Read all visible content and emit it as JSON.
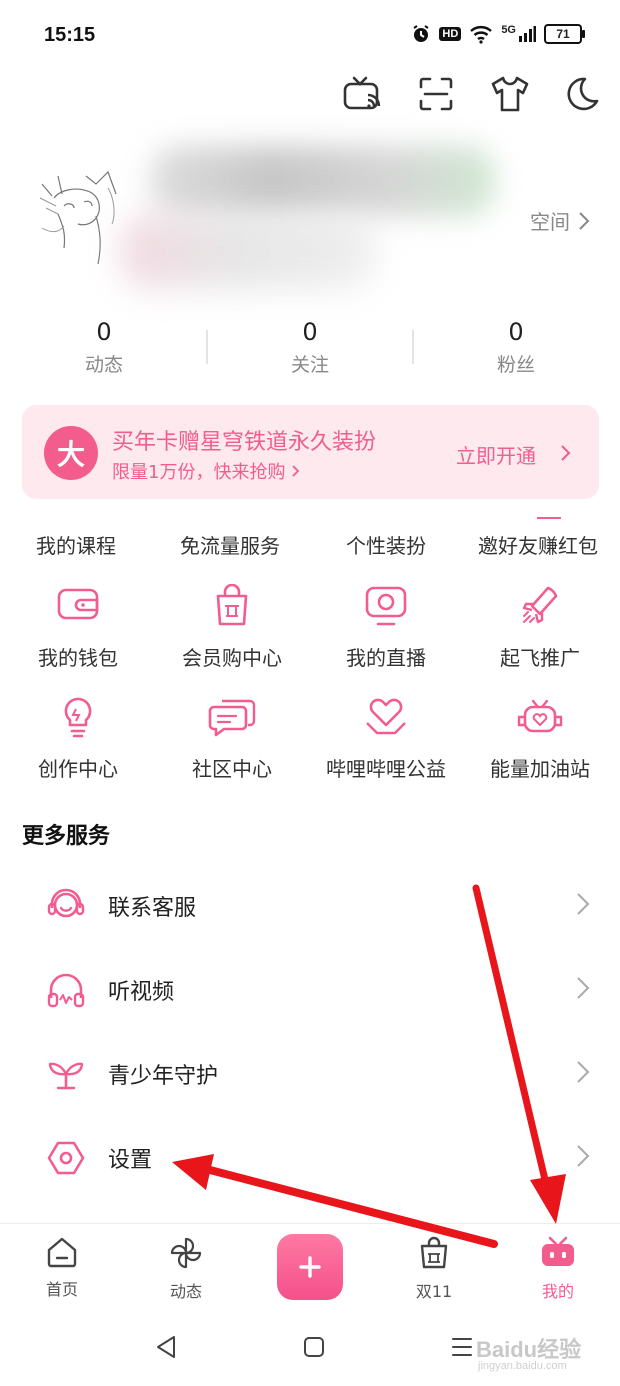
{
  "status_bar": {
    "time": "15:15",
    "hd": "HD",
    "network": "5G",
    "battery": "71"
  },
  "toolbar": {
    "icons": [
      "tv-cast-icon",
      "scan-icon",
      "outfit-icon",
      "night-mode-icon"
    ]
  },
  "profile": {
    "space_label": "空间"
  },
  "stats": [
    {
      "value": "0",
      "label": "动态"
    },
    {
      "value": "0",
      "label": "关注"
    },
    {
      "value": "0",
      "label": "粉丝"
    }
  ],
  "banner": {
    "badge": "大",
    "title": "买年卡赠星穹铁道永久装扮",
    "subtitle": "限量1万份，快来抢购",
    "cta": "立即开通"
  },
  "tabs": [
    "我的课程",
    "免流量服务",
    "个性装扮",
    "邀好友赚红包"
  ],
  "grid": [
    {
      "label": "我的钱包",
      "icon": "wallet-icon"
    },
    {
      "label": "会员购中心",
      "icon": "shopping-bag-icon"
    },
    {
      "label": "我的直播",
      "icon": "live-tv-icon"
    },
    {
      "label": "起飞推广",
      "icon": "rocket-icon"
    },
    {
      "label": "创作中心",
      "icon": "lightbulb-icon"
    },
    {
      "label": "社区中心",
      "icon": "chat-icon"
    },
    {
      "label": "哔哩哔哩公益",
      "icon": "heart-hands-icon"
    },
    {
      "label": "能量加油站",
      "icon": "energy-icon"
    }
  ],
  "more_services": {
    "title": "更多服务",
    "items": [
      {
        "label": "联系客服",
        "icon": "headset-icon"
      },
      {
        "label": "听视频",
        "icon": "headphones-icon"
      },
      {
        "label": "青少年守护",
        "icon": "sprout-icon"
      },
      {
        "label": "设置",
        "icon": "gear-icon"
      }
    ]
  },
  "bottom_nav": [
    {
      "label": "首页",
      "icon": "home-icon"
    },
    {
      "label": "动态",
      "icon": "pinwheel-icon"
    },
    {
      "label": "双11",
      "icon": "bag-icon"
    },
    {
      "label": "我的",
      "icon": "tv-face-icon",
      "active": true
    }
  ],
  "colors": {
    "accent": "#f25d8e",
    "banner_bg": "#fde9ee",
    "annotation_arrow": "#e8151b"
  },
  "watermark": {
    "brand": "Baidu经验",
    "url": "jingyan.baidu.com"
  }
}
